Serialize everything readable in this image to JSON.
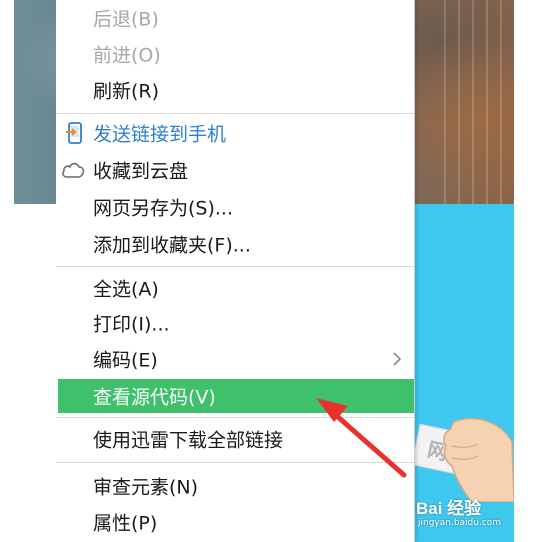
{
  "menu": {
    "items": [
      {
        "label": "后退(B)",
        "state": "disabled"
      },
      {
        "label": "前进(O)",
        "state": "disabled"
      },
      {
        "label": "刷新(R)",
        "state": "normal"
      },
      {
        "label": "发送链接到手机",
        "state": "highlight",
        "icon": "phone-send-icon"
      },
      {
        "label": "收藏到云盘",
        "state": "normal",
        "icon": "cloud-icon"
      },
      {
        "label": "网页另存为(S)...",
        "state": "normal"
      },
      {
        "label": "添加到收藏夹(F)...",
        "state": "normal"
      },
      {
        "label": "全选(A)",
        "state": "normal"
      },
      {
        "label": "打印(I)...",
        "state": "normal"
      },
      {
        "label": "编码(E)",
        "state": "normal",
        "submenu": true
      },
      {
        "label": "查看源代码(V)",
        "state": "selected"
      },
      {
        "label": "使用迅雷下载全部链接",
        "state": "normal"
      },
      {
        "label": "审查元素(N)",
        "state": "normal"
      },
      {
        "label": "属性(P)",
        "state": "normal"
      }
    ]
  },
  "watermark": {
    "logo": "Bai 经验",
    "url": "jingyan.baidu.com"
  },
  "background_card": {
    "text": "网"
  },
  "colors": {
    "selected_bg": "#3ec16a",
    "highlight_text": "#2e7fd1",
    "disabled_text": "#a7a7a7",
    "arrow": "#e8322e",
    "cyan_panel": "#3ec8f0"
  }
}
